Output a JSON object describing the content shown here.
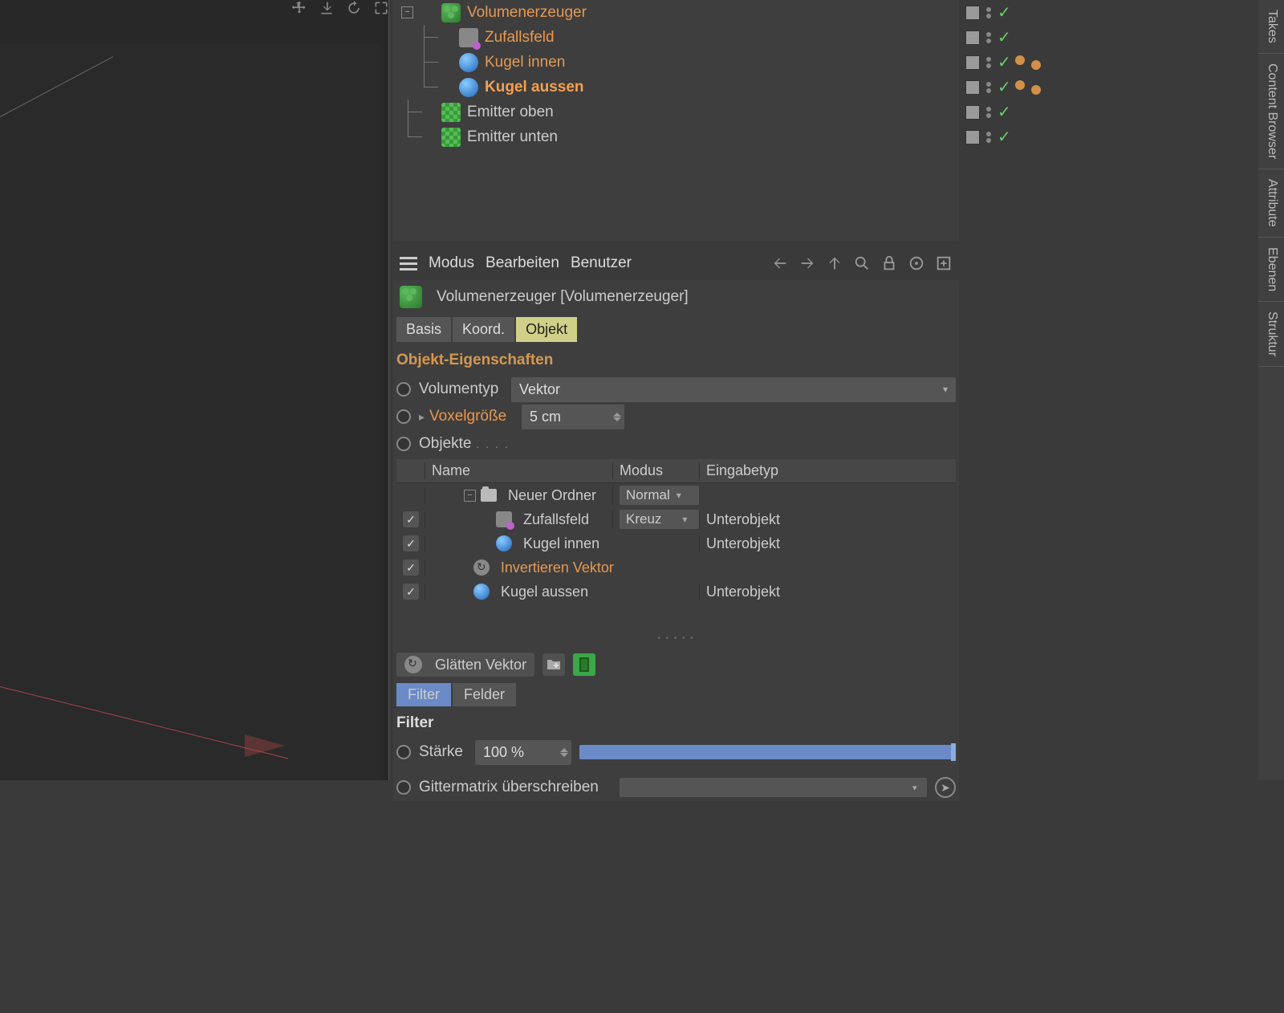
{
  "objectManager": {
    "items": [
      {
        "name": "Volumenerzeuger",
        "type": "volume",
        "indent": 0,
        "orange": true,
        "expandable": true
      },
      {
        "name": "Zufallsfeld",
        "type": "random",
        "indent": 1,
        "orange": true
      },
      {
        "name": "Kugel innen",
        "type": "sphere",
        "indent": 1,
        "orange": true,
        "tags": true
      },
      {
        "name": "Kugel aussen",
        "type": "sphere",
        "indent": 1,
        "selected": true,
        "tags": true
      },
      {
        "name": "Emitter oben",
        "type": "emitter",
        "indent": 0
      },
      {
        "name": "Emitter unten",
        "type": "emitter",
        "indent": 0
      }
    ]
  },
  "attributeHeader": {
    "menu1": "Modus",
    "menu2": "Bearbeiten",
    "menu3": "Benutzer"
  },
  "attributeTitle": "Volumenerzeuger [Volumenerzeuger]",
  "tabs": {
    "t1": "Basis",
    "t2": "Koord.",
    "t3": "Objekt"
  },
  "sectionTitle": "Objekt-Eigenschaften",
  "props": {
    "volumentyp_label": "Volumentyp",
    "volumentyp_value": "Vektor",
    "voxel_label": "Voxelgröße",
    "voxel_value": "5 cm",
    "objekte_label": "Objekte"
  },
  "objList": {
    "headers": {
      "name": "Name",
      "mode": "Modus",
      "input": "Eingabetyp"
    },
    "rows": [
      {
        "name": "Neuer Ordner",
        "type": "folder",
        "indent": 1,
        "mode": "Normal",
        "chk": false
      },
      {
        "name": "Zufallsfeld",
        "type": "random",
        "indent": 2,
        "mode": "Kreuz",
        "input": "Unterobjekt",
        "chk": true
      },
      {
        "name": "Kugel innen",
        "type": "sphere",
        "indent": 2,
        "input": "Unterobjekt",
        "chk": true
      },
      {
        "name": "Invertieren Vektor",
        "type": "invert",
        "indent": 1,
        "orange": true,
        "chk": true
      },
      {
        "name": "Kugel aussen",
        "type": "sphere",
        "indent": 1,
        "input": "Unterobjekt",
        "chk": true
      }
    ]
  },
  "filterChip": "Glätten Vektor",
  "filterTabs": {
    "t1": "Filter",
    "t2": "Felder"
  },
  "filterSection": "Filter",
  "strength": {
    "label": "Stärke",
    "value": "100 %"
  },
  "gitter_label": "Gittermatrix überschreiben",
  "sideTabs": {
    "t1": "Takes",
    "t2": "Content Browser",
    "t3": "Attribute",
    "t4": "Ebenen",
    "t5": "Struktur"
  }
}
